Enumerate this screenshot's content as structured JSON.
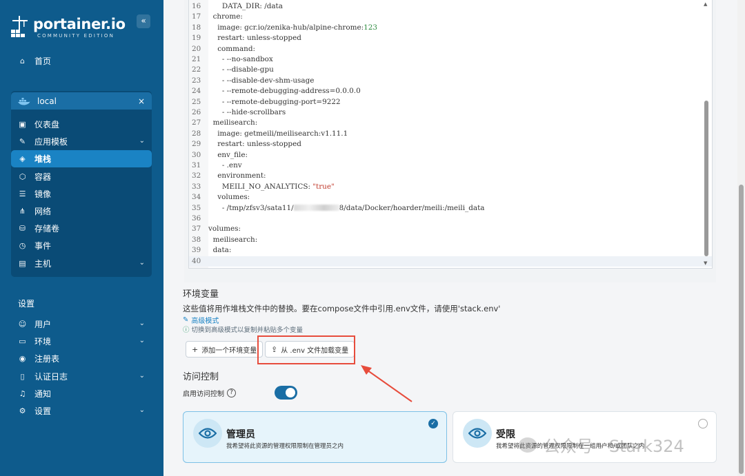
{
  "brand": {
    "name": "portainer.io",
    "edition": "COMMUNITY EDITION",
    "collapse": "«"
  },
  "sidebar": {
    "home": "首页",
    "environment": {
      "name": "local",
      "close": "×"
    },
    "env_items": [
      {
        "label": "仪表盘",
        "icon": "dashboard-icon",
        "chevron": false,
        "active": false
      },
      {
        "label": "应用模板",
        "icon": "edit-icon",
        "chevron": true,
        "active": false
      },
      {
        "label": "堆栈",
        "icon": "layers-icon",
        "chevron": false,
        "active": true
      },
      {
        "label": "容器",
        "icon": "cube-icon",
        "chevron": false,
        "active": false
      },
      {
        "label": "镜像",
        "icon": "list-icon",
        "chevron": false,
        "active": false
      },
      {
        "label": "网络",
        "icon": "share-icon",
        "chevron": false,
        "active": false
      },
      {
        "label": "存储卷",
        "icon": "database-icon",
        "chevron": false,
        "active": false
      },
      {
        "label": "事件",
        "icon": "clock-icon",
        "chevron": false,
        "active": false
      },
      {
        "label": "主机",
        "icon": "host-icon",
        "chevron": true,
        "active": false
      }
    ],
    "settings_title": "设置",
    "settings_items": [
      {
        "label": "用户",
        "icon": "users-icon",
        "chevron": true
      },
      {
        "label": "环境",
        "icon": "hdd-icon",
        "chevron": true
      },
      {
        "label": "注册表",
        "icon": "radio-icon",
        "chevron": false
      },
      {
        "label": "认证日志",
        "icon": "file-icon",
        "chevron": true
      },
      {
        "label": "通知",
        "icon": "bell-icon",
        "chevron": false
      },
      {
        "label": "设置",
        "icon": "gear-icon",
        "chevron": true
      }
    ]
  },
  "editor": {
    "lines": [
      {
        "n": "16",
        "code": "      DATA_DIR: /data"
      },
      {
        "n": "17",
        "code": "  chrome:"
      },
      {
        "n": "18",
        "code": "    image: gcr.io/zenika-hub/alpine-chrome:",
        "num": "123"
      },
      {
        "n": "19",
        "code": "    restart: unless-stopped"
      },
      {
        "n": "20",
        "code": "    command:"
      },
      {
        "n": "21",
        "code": "      - --no-sandbox"
      },
      {
        "n": "22",
        "code": "      - --disable-gpu"
      },
      {
        "n": "23",
        "code": "      - --disable-dev-shm-usage"
      },
      {
        "n": "24",
        "code": "      - --remote-debugging-address=0.0.0.0"
      },
      {
        "n": "25",
        "code": "      - --remote-debugging-port=9222"
      },
      {
        "n": "26",
        "code": "      - --hide-scrollbars"
      },
      {
        "n": "27",
        "code": "  meilisearch:"
      },
      {
        "n": "28",
        "code": "    image: getmeili/meilisearch:v1.11.1"
      },
      {
        "n": "29",
        "code": "    restart: unless-stopped"
      },
      {
        "n": "30",
        "code": "    env_file:"
      },
      {
        "n": "31",
        "code": "      - .env"
      },
      {
        "n": "32",
        "code": "    environment:"
      },
      {
        "n": "33",
        "code": "      MEILI_NO_ANALYTICS: ",
        "str": "\"true\""
      },
      {
        "n": "34",
        "code": "    volumes:"
      },
      {
        "n": "35",
        "code": "      - /tmp/zfsv3/sata11/",
        "blur": true,
        "after": "8/data/Docker/hoarder/meili:/meili_data"
      },
      {
        "n": "36",
        "code": ""
      },
      {
        "n": "37",
        "code": "volumes:"
      },
      {
        "n": "38",
        "code": "  meilisearch:"
      },
      {
        "n": "39",
        "code": "  data:"
      },
      {
        "n": "40",
        "code": "",
        "current": true
      }
    ]
  },
  "env_vars": {
    "title": "环境变量",
    "description": "这些值将用作堆栈文件中的替换。要在compose文件中引用.env文件，请使用'stack.env'",
    "advanced_link": "高级模式",
    "advanced_hint": "切换到高级模式以复制并粘贴多个变量",
    "add_button": "添加一个环境变量",
    "load_button": "从 .env 文件加载变量"
  },
  "access": {
    "title": "访问控制",
    "enable_label": "启用访问控制",
    "enabled": true,
    "admin": {
      "title": "管理员",
      "desc": "我希望将此资源的管理权限限制在管理员之内",
      "selected": true
    },
    "restricted": {
      "title": "受限",
      "desc": "我希望将此资源的管理权限限制在一组用户和/或团队之内",
      "selected": false
    }
  },
  "watermark": "公众号 · Stark324",
  "colors": {
    "sidebar": "#0e5b8c",
    "active": "#1a83c4",
    "highlight": "#e74c3c",
    "accent": "#1a6ea5"
  }
}
